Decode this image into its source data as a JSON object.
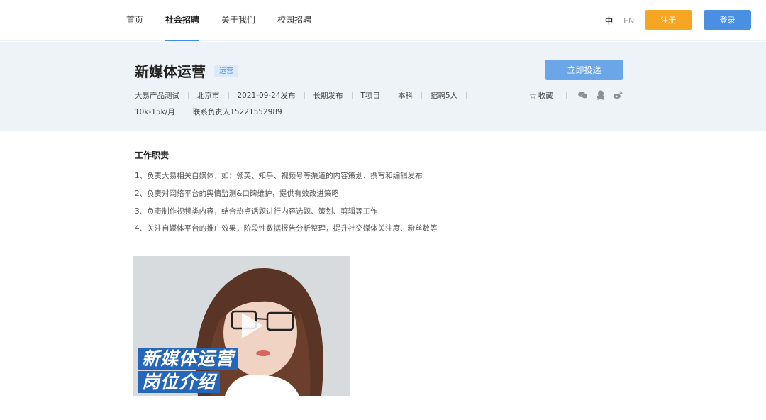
{
  "nav": {
    "links": [
      "首页",
      "社会招聘",
      "关于我们",
      "校园招聘"
    ],
    "active_index": 1,
    "lang_zh": "中",
    "lang_en": "EN",
    "register_label": "注册",
    "login_label": "登录"
  },
  "job": {
    "title": "新媒体运营",
    "tag": "运营",
    "apply_label": "立即投递",
    "meta_row1": [
      "大易产品测试",
      "北京市",
      "2021-09-24发布",
      "长期发布",
      "T项目",
      "本科",
      "招聘5人"
    ],
    "meta_row2": [
      "10k-15k/月",
      "联系负责人15221552989"
    ],
    "favorite_label": "收藏",
    "share_icons": [
      "wechat-icon",
      "qq-icon",
      "weibo-icon"
    ]
  },
  "description": {
    "section_title": "工作职责",
    "duties": [
      "1、负责大易相关自媒体，如：领英、知乎、视频号等渠道的内容策划、撰写和编辑发布",
      "2、负责对网络平台的舆情监测&口碑维护，提供有效改进策略",
      "3、负责制作视频类内容，结合热点话题进行内容选题、策划、剪辑等工作",
      "4、关注自媒体平台的推广效果，阶段性数据报告分析整理，提升社交媒体关注度、粉丝数等"
    ]
  },
  "video": {
    "caption_line1": "新媒体运营",
    "caption_line2": "岗位介绍"
  },
  "colors": {
    "accent": "#4a90e2",
    "register": "#f5a623",
    "apply": "#6aa6e8",
    "header_bg": "#eef3f7"
  }
}
